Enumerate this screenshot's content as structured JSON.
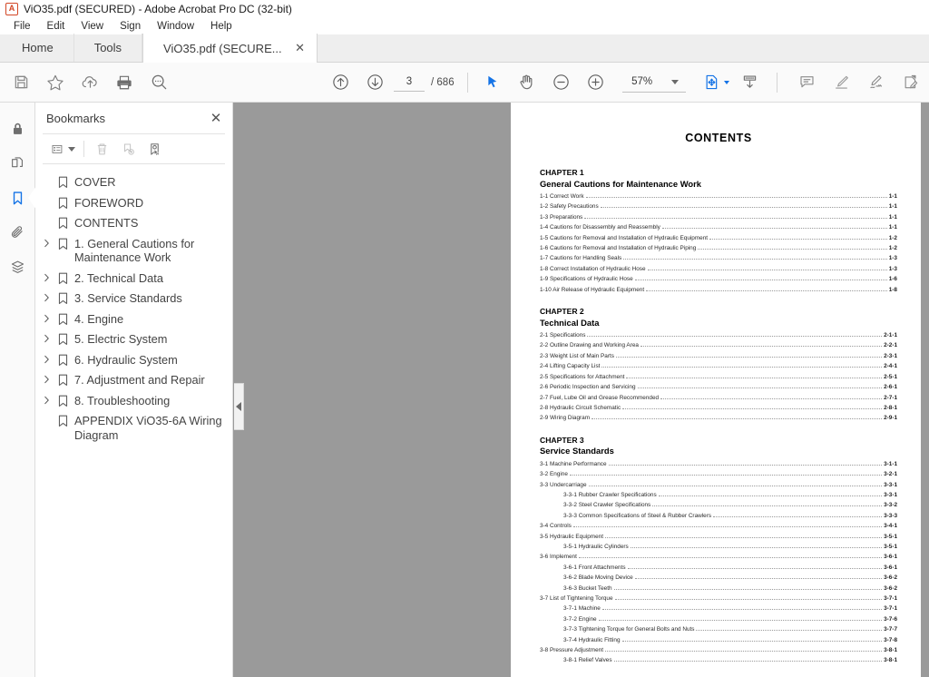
{
  "window": {
    "title": "ViO35.pdf (SECURED) - Adobe Acrobat Pro DC (32-bit)",
    "app_icon": "A"
  },
  "menubar": {
    "items": [
      {
        "label": "File"
      },
      {
        "label": "Edit"
      },
      {
        "label": "View"
      },
      {
        "label": "Sign"
      },
      {
        "label": "Window"
      },
      {
        "label": "Help"
      }
    ]
  },
  "tabs": [
    {
      "label": "Home",
      "type": "home"
    },
    {
      "label": "Tools",
      "type": "tools"
    },
    {
      "label": "ViO35.pdf (SECURE...",
      "type": "document",
      "close": "✕",
      "active": true
    }
  ],
  "toolbar": {
    "left_tools": [
      {
        "name": "save-icon",
        "title": "Save"
      },
      {
        "name": "star-icon",
        "title": "Add to favorites"
      },
      {
        "name": "cloud-upload-icon",
        "title": "Upload to cloud"
      },
      {
        "name": "print-icon",
        "title": "Print"
      },
      {
        "name": "search-icon",
        "title": "Find"
      }
    ],
    "nav": {
      "previous_page_title": "Previous page",
      "next_page_title": "Next page",
      "current_page": "3",
      "page_separator": "/",
      "total_pages": "686"
    },
    "view_tools": [
      {
        "name": "select-cursor-icon",
        "title": "Select tool"
      },
      {
        "name": "hand-tool-icon",
        "title": "Hand tool"
      },
      {
        "name": "zoom-out-icon",
        "title": "Zoom out"
      },
      {
        "name": "zoom-in-icon",
        "title": "Zoom in"
      }
    ],
    "zoom": {
      "value": "57%"
    },
    "fit_tools": [
      {
        "name": "fit-page-icon",
        "title": "Fit page"
      },
      {
        "name": "scroll-mode-icon",
        "title": "Page display"
      }
    ],
    "right_tools": [
      {
        "name": "comment-icon",
        "title": "Add comment"
      },
      {
        "name": "highlight-icon",
        "title": "Highlight text"
      },
      {
        "name": "sign-icon",
        "title": "Sign"
      },
      {
        "name": "fill-and-sign-icon",
        "title": "Fill & Sign"
      }
    ]
  },
  "rail": {
    "items": [
      {
        "name": "security-lock-icon",
        "label": "Security",
        "active": false
      },
      {
        "name": "page-thumbnails-icon",
        "label": "Page Thumbnails",
        "active": false
      },
      {
        "name": "bookmarks-icon",
        "label": "Bookmarks",
        "active": true
      },
      {
        "name": "attachments-icon",
        "label": "Attachments",
        "active": false
      },
      {
        "name": "layers-icon",
        "label": "Layers",
        "active": false
      }
    ]
  },
  "bookmarks_panel": {
    "title": "Bookmarks",
    "close_label": "✕",
    "toolbar": [
      {
        "name": "bookmark-options-icon",
        "label": "Options",
        "disabled": false
      },
      {
        "name": "delete-bookmark-icon",
        "label": "Delete bookmark",
        "disabled": true
      },
      {
        "name": "new-bookmark-icon",
        "label": "New bookmark",
        "disabled": true
      },
      {
        "name": "select-bookmark-icon",
        "label": "Find current bookmark",
        "disabled": false
      }
    ],
    "items": [
      {
        "label": "COVER",
        "expandable": false
      },
      {
        "label": "FOREWORD",
        "expandable": false
      },
      {
        "label": "CONTENTS",
        "expandable": false
      },
      {
        "label": "1. General Cautions for Maintenance Work",
        "expandable": true
      },
      {
        "label": "2. Technical Data",
        "expandable": true
      },
      {
        "label": "3. Service Standards",
        "expandable": true
      },
      {
        "label": "4. Engine",
        "expandable": true
      },
      {
        "label": "5. Electric System",
        "expandable": true
      },
      {
        "label": "6. Hydraulic System",
        "expandable": true
      },
      {
        "label": "7. Adjustment and Repair",
        "expandable": true
      },
      {
        "label": "8. Troubleshooting",
        "expandable": true
      },
      {
        "label": "APPENDIX ViO35-6A Wiring Diagram",
        "expandable": false
      }
    ]
  },
  "collapse_handle": {
    "name": "collapse-panel-handle"
  },
  "document": {
    "title": "CONTENTS",
    "chapters": [
      {
        "heading": "CHAPTER 1",
        "subheading": "General Cautions for Maintenance Work",
        "entries": [
          {
            "text": "1-1 Correct Work",
            "page": "1-1",
            "level": 1
          },
          {
            "text": "1-2 Safety Precautions",
            "page": "1-1",
            "level": 1
          },
          {
            "text": "1-3 Preparations",
            "page": "1-1",
            "level": 1
          },
          {
            "text": "1-4 Cautions for Disassembly and Reassembly",
            "page": "1-1",
            "level": 1
          },
          {
            "text": "1-5 Cautions for Removal and Installation of Hydraulic Equipment",
            "page": "1-2",
            "level": 1
          },
          {
            "text": "1-6 Cautions for Removal and Installation of Hydraulic Piping",
            "page": "1-2",
            "level": 1
          },
          {
            "text": "1-7 Cautions for Handling Seals",
            "page": "1-3",
            "level": 1
          },
          {
            "text": "1-8 Correct Installation of Hydraulic Hose",
            "page": "1-3",
            "level": 1
          },
          {
            "text": "1-9 Specifications of Hydraulic Hose",
            "page": "1-6",
            "level": 1
          },
          {
            "text": "1-10 Air Release of Hydraulic Equipment",
            "page": "1-8",
            "level": 1
          }
        ]
      },
      {
        "heading": "CHAPTER 2",
        "subheading": "Technical Data",
        "entries": [
          {
            "text": "2-1 Specifications",
            "page": "2-1-1",
            "level": 1
          },
          {
            "text": "2-2 Outline Drawing and Working Area",
            "page": "2-2-1",
            "level": 1
          },
          {
            "text": "2-3 Weight List of Main Parts",
            "page": "2-3-1",
            "level": 1
          },
          {
            "text": "2-4 Lifting Capacity List",
            "page": "2-4-1",
            "level": 1
          },
          {
            "text": "2-5 Specifications for Attachment",
            "page": "2-5-1",
            "level": 1
          },
          {
            "text": "2-6 Periodic Inspection and Servicing",
            "page": "2-6-1",
            "level": 1
          },
          {
            "text": "2-7 Fuel, Lube Oil and Grease Recommended",
            "page": "2-7-1",
            "level": 1
          },
          {
            "text": "2-8 Hydraulic Circuit Schematic",
            "page": "2-8-1",
            "level": 1
          },
          {
            "text": "2-9 Wiring Diagram",
            "page": "2-9-1",
            "level": 1
          }
        ]
      },
      {
        "heading": "CHAPTER 3",
        "subheading": "Service Standards",
        "entries": [
          {
            "text": "3-1 Machine Performance",
            "page": "3-1-1",
            "level": 1
          },
          {
            "text": "3-2 Engine",
            "page": "3-2-1",
            "level": 1
          },
          {
            "text": "3-3 Undercarriage",
            "page": "3-3-1",
            "level": 1
          },
          {
            "text": "3-3-1 Rubber Crawler Specifications",
            "page": "3-3-1",
            "level": 2
          },
          {
            "text": "3-3-2 Steel Crawler Specifications",
            "page": "3-3-2",
            "level": 2
          },
          {
            "text": "3-3-3 Common Specifications of Steel & Rubber Crawlers",
            "page": "3-3-3",
            "level": 2
          },
          {
            "text": "3-4 Controls",
            "page": "3-4-1",
            "level": 1
          },
          {
            "text": "3-5 Hydraulic Equipment",
            "page": "3-5-1",
            "level": 1
          },
          {
            "text": "3-5-1 Hydraulic Cylinders",
            "page": "3-5-1",
            "level": 2
          },
          {
            "text": "3-6 Implement",
            "page": "3-6-1",
            "level": 1
          },
          {
            "text": "3-6-1 Front Attachments",
            "page": "3-6-1",
            "level": 2
          },
          {
            "text": "3-6-2 Blade Moving Device",
            "page": "3-6-2",
            "level": 2
          },
          {
            "text": "3-6-3 Bucket Teeth",
            "page": "3-6-2",
            "level": 2
          },
          {
            "text": "3-7 List of Tightening Torque",
            "page": "3-7-1",
            "level": 1
          },
          {
            "text": "3-7-1 Machine",
            "page": "3-7-1",
            "level": 2
          },
          {
            "text": "3-7-2 Engine",
            "page": "3-7-6",
            "level": 2
          },
          {
            "text": "3-7-3 Tightening Torque for General Bolts and Nuts",
            "page": "3-7-7",
            "level": 2
          },
          {
            "text": "3-7-4 Hydraulic Fitting",
            "page": "3-7-8",
            "level": 2
          },
          {
            "text": "3-8 Pressure Adjustment",
            "page": "3-8-1",
            "level": 1
          },
          {
            "text": "3-8-1 Relief Valves",
            "page": "3-8-1",
            "level": 2
          }
        ]
      }
    ]
  },
  "colors": {
    "accent": "#1473e6",
    "viewer_background": "#9a9a9a",
    "toolbar_background": "#fafafa",
    "app_icon": "#d24726"
  }
}
